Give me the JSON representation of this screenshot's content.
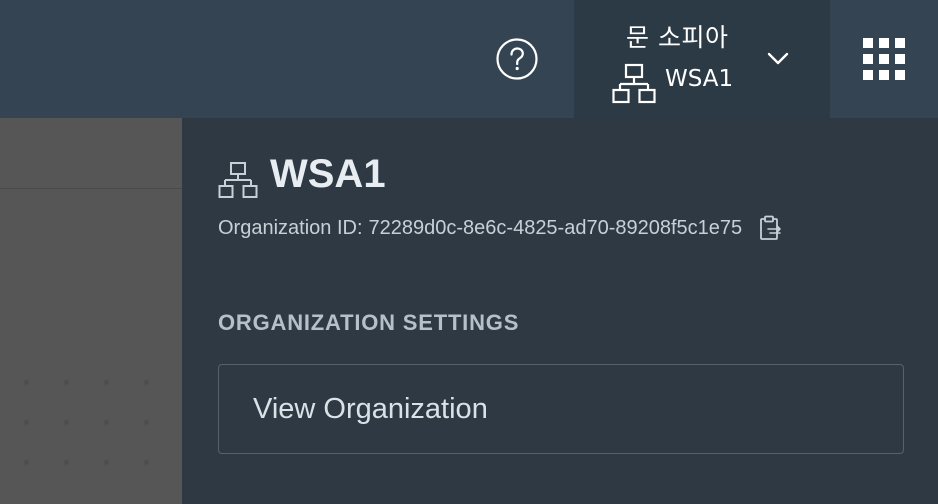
{
  "header": {
    "help_icon": "help-circle-icon",
    "user": {
      "name": "문 소피아",
      "org_icon": "organization-icon",
      "org_name": "WSA1",
      "chevron_icon": "chevron-down-icon"
    },
    "app_switcher_icon": "grid-9-dots-icon"
  },
  "panel": {
    "org_icon": "organization-icon",
    "org_title": "WSA1",
    "org_id_label": "Organization ID:",
    "org_id_value": "72289d0c-8e6c-4825-ad70-89208f5c1e75",
    "copy_icon": "copy-clipboard-icon",
    "section_heading": "ORGANIZATION SETTINGS",
    "view_org_label": "View Organization"
  },
  "colors": {
    "header_bg": "#344452",
    "user_menu_bg": "#2c3a45",
    "panel_bg": "#2e3944",
    "backdrop": "#565656"
  }
}
